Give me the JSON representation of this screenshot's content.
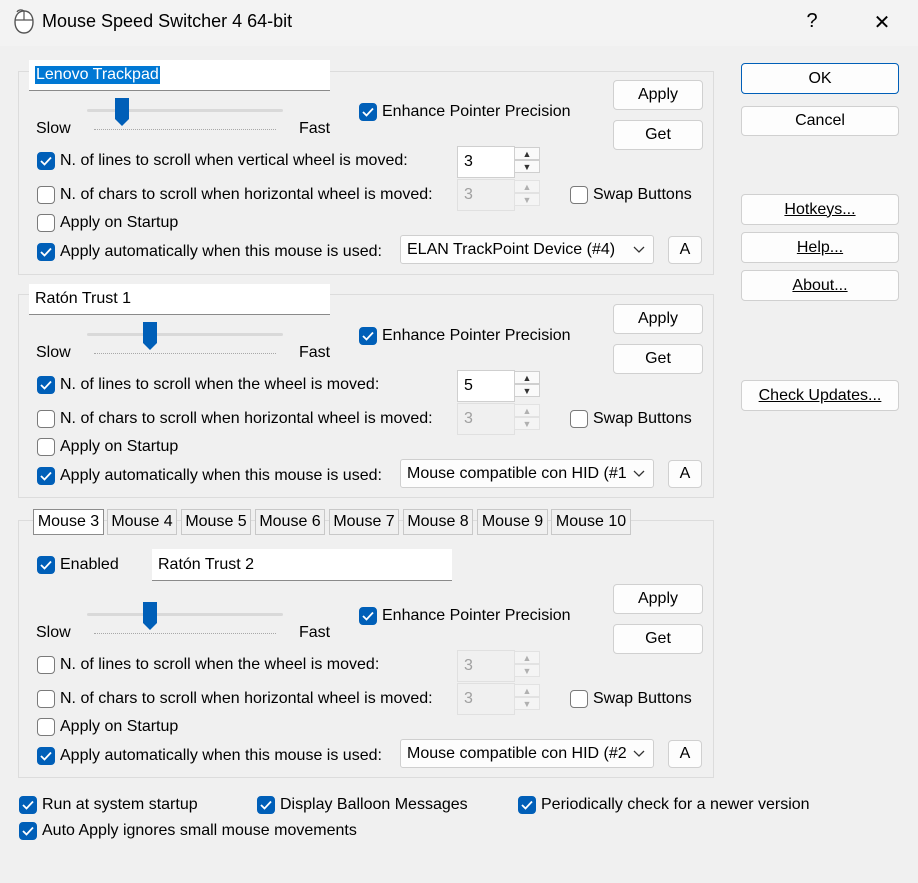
{
  "window": {
    "title": "Mouse Speed Switcher 4 64-bit",
    "help_glyph": "?",
    "close_glyph": "✕"
  },
  "accent_color": "#005fb8",
  "slider_labels": {
    "slow": "Slow",
    "fast": "Fast"
  },
  "mouse1": {
    "name": "Lenovo Trackpad",
    "speed_fraction": 0.18,
    "enhance_label": "Enhance Pointer Precision",
    "enhance_checked": true,
    "apply_label": "Apply",
    "get_label": "Get",
    "lines_label": "N. of lines to scroll when vertical wheel is moved:",
    "lines_checked": true,
    "lines_value": "3",
    "chars_label": "N. of chars to scroll when  horizontal wheel is moved:",
    "chars_checked": false,
    "chars_value": "3",
    "swap_label": "Swap Buttons",
    "swap_checked": false,
    "startup_label": "Apply on Startup",
    "startup_checked": false,
    "auto_label": "Apply automatically when this mouse is used:",
    "auto_checked": true,
    "device": "ELAN TrackPoint Device (#4)",
    "a_label": "A"
  },
  "mouse2": {
    "name": "Ratón Trust 1",
    "speed_fraction": 0.32,
    "enhance_label": "Enhance Pointer Precision",
    "enhance_checked": true,
    "apply_label": "Apply",
    "get_label": "Get",
    "lines_label": "N. of lines to scroll when the wheel is moved:",
    "lines_checked": true,
    "lines_value": "5",
    "chars_label": "N. of chars to scroll when  horizontal wheel is moved:",
    "chars_checked": false,
    "chars_value": "3",
    "swap_label": "Swap Buttons",
    "swap_checked": false,
    "startup_label": "Apply on Startup",
    "startup_checked": false,
    "auto_label": "Apply automatically when this mouse is used:",
    "auto_checked": true,
    "device": "Mouse compatible con HID (#1",
    "a_label": "A"
  },
  "tabs": [
    "Mouse 3",
    "Mouse 4",
    "Mouse 5",
    "Mouse 6",
    "Mouse 7",
    "Mouse 8",
    "Mouse 9",
    "Mouse 10"
  ],
  "selected_tab": 0,
  "mouse3": {
    "enabled_label": "Enabled",
    "enabled_checked": true,
    "name": "Ratón Trust 2",
    "speed_fraction": 0.32,
    "enhance_label": "Enhance Pointer Precision",
    "enhance_checked": true,
    "apply_label": "Apply",
    "get_label": "Get",
    "lines_label": "N. of lines to scroll when the wheel is moved:",
    "lines_checked": false,
    "lines_value": "3",
    "chars_label": "N. of chars to scroll when  horizontal wheel is moved:",
    "chars_checked": false,
    "chars_value": "3",
    "swap_label": "Swap Buttons",
    "swap_checked": false,
    "startup_label": "Apply on Startup",
    "startup_checked": false,
    "auto_label": "Apply automatically when this mouse is used:",
    "auto_checked": true,
    "device": "Mouse compatible con HID (#2",
    "a_label": "A"
  },
  "buttons": {
    "ok": "OK",
    "cancel": "Cancel",
    "hotkeys": "Hotkeys...",
    "help": "Help...",
    "about": "About...",
    "updates": "Check Updates..."
  },
  "options": {
    "run_startup": {
      "label": "Run at system startup",
      "checked": true
    },
    "balloon": {
      "label": "Display Balloon Messages",
      "checked": true
    },
    "check_newer": {
      "label": "Periodically check for a newer version",
      "checked": true
    },
    "auto_apply_ignore": {
      "label": "Auto Apply ignores small mouse movements",
      "checked": true
    }
  }
}
